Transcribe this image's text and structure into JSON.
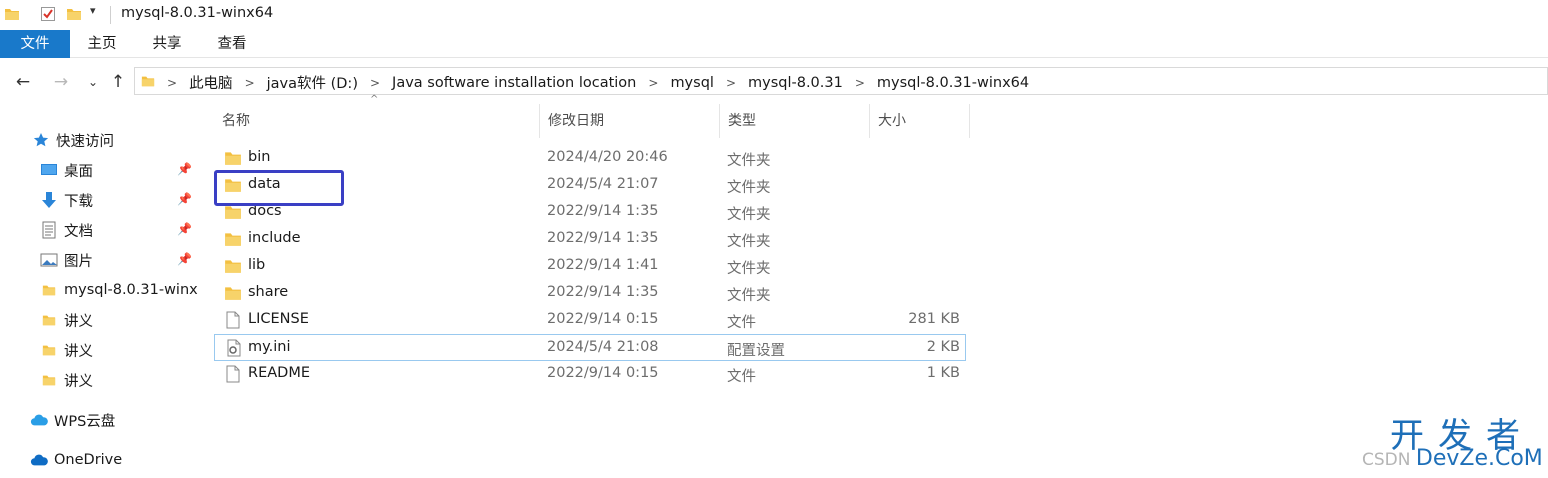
{
  "window": {
    "title": "mysql-8.0.31-winx64"
  },
  "ribbon": {
    "tabs": [
      "文件",
      "主页",
      "共享",
      "查看"
    ]
  },
  "address": {
    "crumbs": [
      "此电脑",
      "java软件 (D:)",
      "Java software installation location",
      "mysql",
      "mysql-8.0.31",
      "mysql-8.0.31-winx64"
    ]
  },
  "sidebar": {
    "quick_access": "快速访问",
    "items": [
      {
        "label": "桌面",
        "icon": "desktop-icon",
        "pinned": true
      },
      {
        "label": "下载",
        "icon": "download-icon",
        "pinned": true
      },
      {
        "label": "文档",
        "icon": "document-icon",
        "pinned": true
      },
      {
        "label": "图片",
        "icon": "picture-icon",
        "pinned": true
      },
      {
        "label": "mysql-8.0.31-winx",
        "icon": "folder-icon",
        "pinned": false
      },
      {
        "label": "讲义",
        "icon": "folder-icon",
        "pinned": false
      },
      {
        "label": "讲义",
        "icon": "folder-icon",
        "pinned": false
      },
      {
        "label": "讲义",
        "icon": "folder-icon",
        "pinned": false
      }
    ],
    "wps": "WPS云盘",
    "onedrive": "OneDrive"
  },
  "columns": {
    "name": "名称",
    "date": "修改日期",
    "type": "类型",
    "size": "大小"
  },
  "files": [
    {
      "name": "bin",
      "date": "2024/4/20 20:46",
      "type": "文件夹",
      "size": "",
      "icon": "folder-icon"
    },
    {
      "name": "data",
      "date": "2024/5/4 21:07",
      "type": "文件夹",
      "size": "",
      "icon": "folder-icon"
    },
    {
      "name": "docs",
      "date": "2022/9/14 1:35",
      "type": "文件夹",
      "size": "",
      "icon": "folder-icon"
    },
    {
      "name": "include",
      "date": "2022/9/14 1:35",
      "type": "文件夹",
      "size": "",
      "icon": "folder-icon"
    },
    {
      "name": "lib",
      "date": "2022/9/14 1:41",
      "type": "文件夹",
      "size": "",
      "icon": "folder-icon"
    },
    {
      "name": "share",
      "date": "2022/9/14 1:35",
      "type": "文件夹",
      "size": "",
      "icon": "folder-icon"
    },
    {
      "name": "LICENSE",
      "date": "2022/9/14 0:15",
      "type": "文件",
      "size": "281 KB",
      "icon": "file-icon"
    },
    {
      "name": "my.ini",
      "date": "2024/5/4 21:08",
      "type": "配置设置",
      "size": "2 KB",
      "icon": "settings-file-icon"
    },
    {
      "name": "README",
      "date": "2022/9/14 0:15",
      "type": "文件",
      "size": "1 KB",
      "icon": "file-icon"
    }
  ],
  "watermark": {
    "big": "开发者",
    "small_prefix": "CSDN",
    "small_brand": "DevZe.CoM"
  },
  "colors": {
    "accent": "#1979ca",
    "folder": "#f3c041",
    "highlight": "#3a3fc4"
  }
}
